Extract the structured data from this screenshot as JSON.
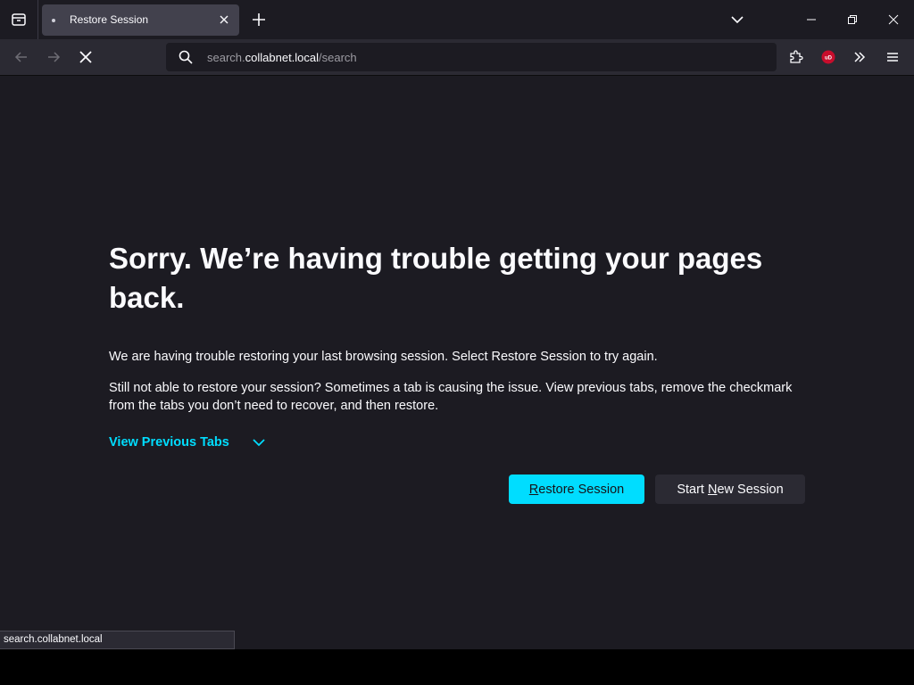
{
  "browser": {
    "tab": {
      "title": "Restore Session"
    },
    "url": {
      "host_prefix": "search.",
      "host": "collabnet.local",
      "path": "/search"
    },
    "status_tooltip": "search.collabnet.local"
  },
  "page": {
    "title": "Sorry. We’re having trouble getting your pages back.",
    "paragraph1": "We are having trouble restoring your last browsing session. Select Restore Session to try again.",
    "paragraph2": "Still not able to restore your session? Sometimes a tab is causing the issue. View previous tabs, remove the checkmark from the tabs you don’t need to recover, and then restore.",
    "view_previous_tabs": "View Previous Tabs",
    "restore_button": {
      "accesskey": "R",
      "rest": "estore Session"
    },
    "new_session_button": {
      "before": "Start ",
      "accesskey": "N",
      "rest": "ew Session"
    }
  },
  "colors": {
    "accent": "#00ddff",
    "content_bg": "#1c1b22",
    "toolbar_bg": "#2b2a33",
    "ublock_red": "#c70d2c"
  },
  "icons": {
    "tab_list": "tab-list-icon",
    "close": "close-icon",
    "new_tab": "plus-icon",
    "back": "arrow-left-icon",
    "forward": "arrow-right-icon",
    "stop": "stop-icon",
    "search": "search-icon",
    "extensions": "puzzle-icon",
    "ublock": "ublock-icon",
    "overflow": "chevron-double-right-icon",
    "menu": "hamburger-menu-icon"
  }
}
